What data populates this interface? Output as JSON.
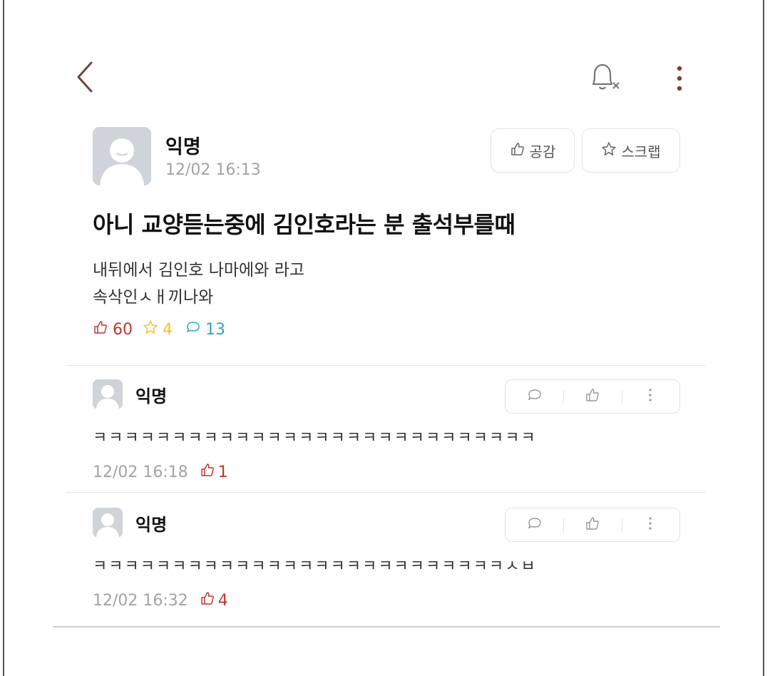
{
  "header": {
    "icons": [
      "back-icon",
      "bell-off-icon",
      "more-vertical-icon"
    ]
  },
  "post": {
    "author": "익명",
    "time": "12/02 16:13",
    "like_label": "공감",
    "scrap_label": "스크랩",
    "title": "아니 교양듣는중에 김인호라는 분 출석부를때",
    "body": "내뒤에서 김인호 나마에와 라고\n속삭인ㅅㅐ끼나와",
    "stats": {
      "likes": "60",
      "comments": "13",
      "scraps": "4"
    }
  },
  "comments": [
    {
      "author": "익명",
      "text": "ㅋㅋㅋㅋㅋㅋㅋㅋㅋㅋㅋㅋㅋㅋㅋㅋㅋㅋㅋㅋㅋㅋㅋㅋㅋㅋㅋㅋ",
      "time": "12/02 16:18",
      "likes": "1"
    },
    {
      "author": "익명",
      "text": "ㅋㅋㅋㅋㅋㅋㅋㅋㅋㅋㅋㅋㅋㅋㅋㅋㅋㅋㅋㅋㅋㅋㅋㅋㅋㅋㅅㅂ",
      "time": "12/02 16:32",
      "likes": "4"
    }
  ],
  "colors": {
    "like": "#c0362c",
    "comment": "#2ba8c4",
    "scrap": "#f2c12e",
    "muted": "#a3a3a3"
  }
}
